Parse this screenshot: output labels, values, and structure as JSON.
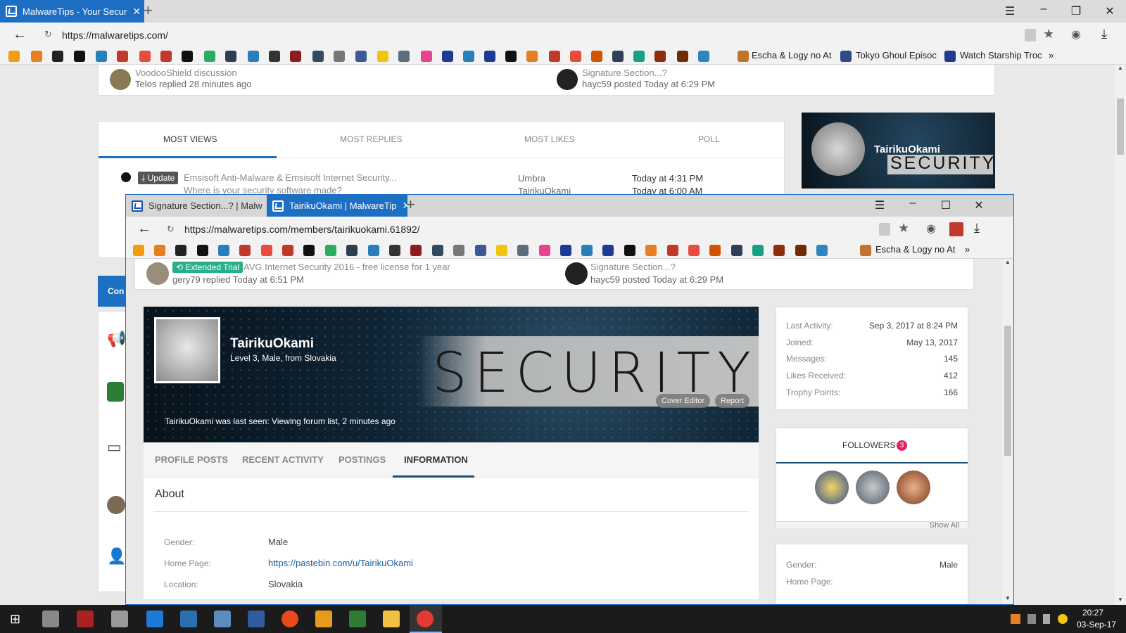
{
  "back_window": {
    "tab_title": "MalwareTips - Your Secur",
    "url": "https://malwaretips.com/",
    "bookmarks": [
      {
        "label": "Escha & Logy no At"
      },
      {
        "label": "Tokyo Ghoul Episoc"
      },
      {
        "label": "Watch Starship Troc"
      }
    ],
    "recent_left": {
      "title": "VoodooShield discussion",
      "user": "Telos",
      "action": "replied 28 minutes ago"
    },
    "recent_right": {
      "title": "Signature Section...?",
      "user": "hayc59",
      "action": "posted Today at 6:29 PM"
    },
    "tabs": [
      "MOST VIEWS",
      "MOST REPLIES",
      "MOST LIKES",
      "POLL"
    ],
    "thread": {
      "badge": "Update",
      "title": "Emsisoft Anti-Malware & Emsisoft Internet Security...",
      "user": "Umbra",
      "time": "Today at 4:31 PM"
    },
    "thread2": {
      "title": "Where is your security software made?",
      "user": "TairikuOkami",
      "time": "Today at 6:00 AM"
    },
    "sidebar_label": "Con",
    "banner": {
      "name": "TairikuOkami",
      "word": "SECURITY"
    }
  },
  "front_window": {
    "tab1": "Signature Section...? | Malw",
    "tab2": "TairikuOkami | MalwareTip",
    "url": "https://malwaretips.com/members/tairikuokami.61892/",
    "bookmark": "Escha & Logy no At",
    "recent_left": {
      "badge": "Extended Trial",
      "title": "AVG Internet Security 2016 - free license for 1 year",
      "user": "gery79",
      "action": "replied Today at 6:51 PM"
    },
    "recent_right": {
      "title": "Signature Section...?",
      "user": "hayc59",
      "action": "posted Today at 6:29 PM"
    },
    "profile": {
      "name": "TairikuOkami",
      "subtitle": "Level 3, Male, from Slovakia",
      "cover_word": "SECURITY",
      "last_seen": "TairikuOkami was last seen: Viewing forum list, 2 minutes ago",
      "cover_editor": "Cover Editor",
      "report": "Report"
    },
    "profile_tabs": [
      "PROFILE POSTS",
      "RECENT ACTIVITY",
      "POSTINGS",
      "INFORMATION"
    ],
    "active_tab": "INFORMATION",
    "about": {
      "heading": "About",
      "gender_label": "Gender:",
      "gender": "Male",
      "homepage_label": "Home Page:",
      "homepage": "https://pastebin.com/u/TairikuOkami",
      "location_label": "Location:",
      "location": "Slovakia"
    },
    "stats": [
      {
        "label": "Last Activity:",
        "value": "Sep 3, 2017 at 8:24 PM"
      },
      {
        "label": "Joined:",
        "value": "May 13, 2017"
      },
      {
        "label": "Messages:",
        "value": "145"
      },
      {
        "label": "Likes Received:",
        "value": "412"
      },
      {
        "label": "Trophy Points:",
        "value": "166"
      }
    ],
    "followers": {
      "title": "FOLLOWERS",
      "count": "3",
      "show_all": "Show All"
    },
    "side_info": {
      "gender_label": "Gender:",
      "gender": "Male",
      "homepage_label": "Home Page:"
    }
  },
  "taskbar": {
    "time": "20:27",
    "date": "03-Sep-17"
  },
  "colors": {
    "accent": "#1d6fc3",
    "active_tab_underline": "#1d4f7a",
    "extended_trial": "#27ae8a",
    "update_badge": "#555555",
    "follower_badge": "#e0245e"
  }
}
